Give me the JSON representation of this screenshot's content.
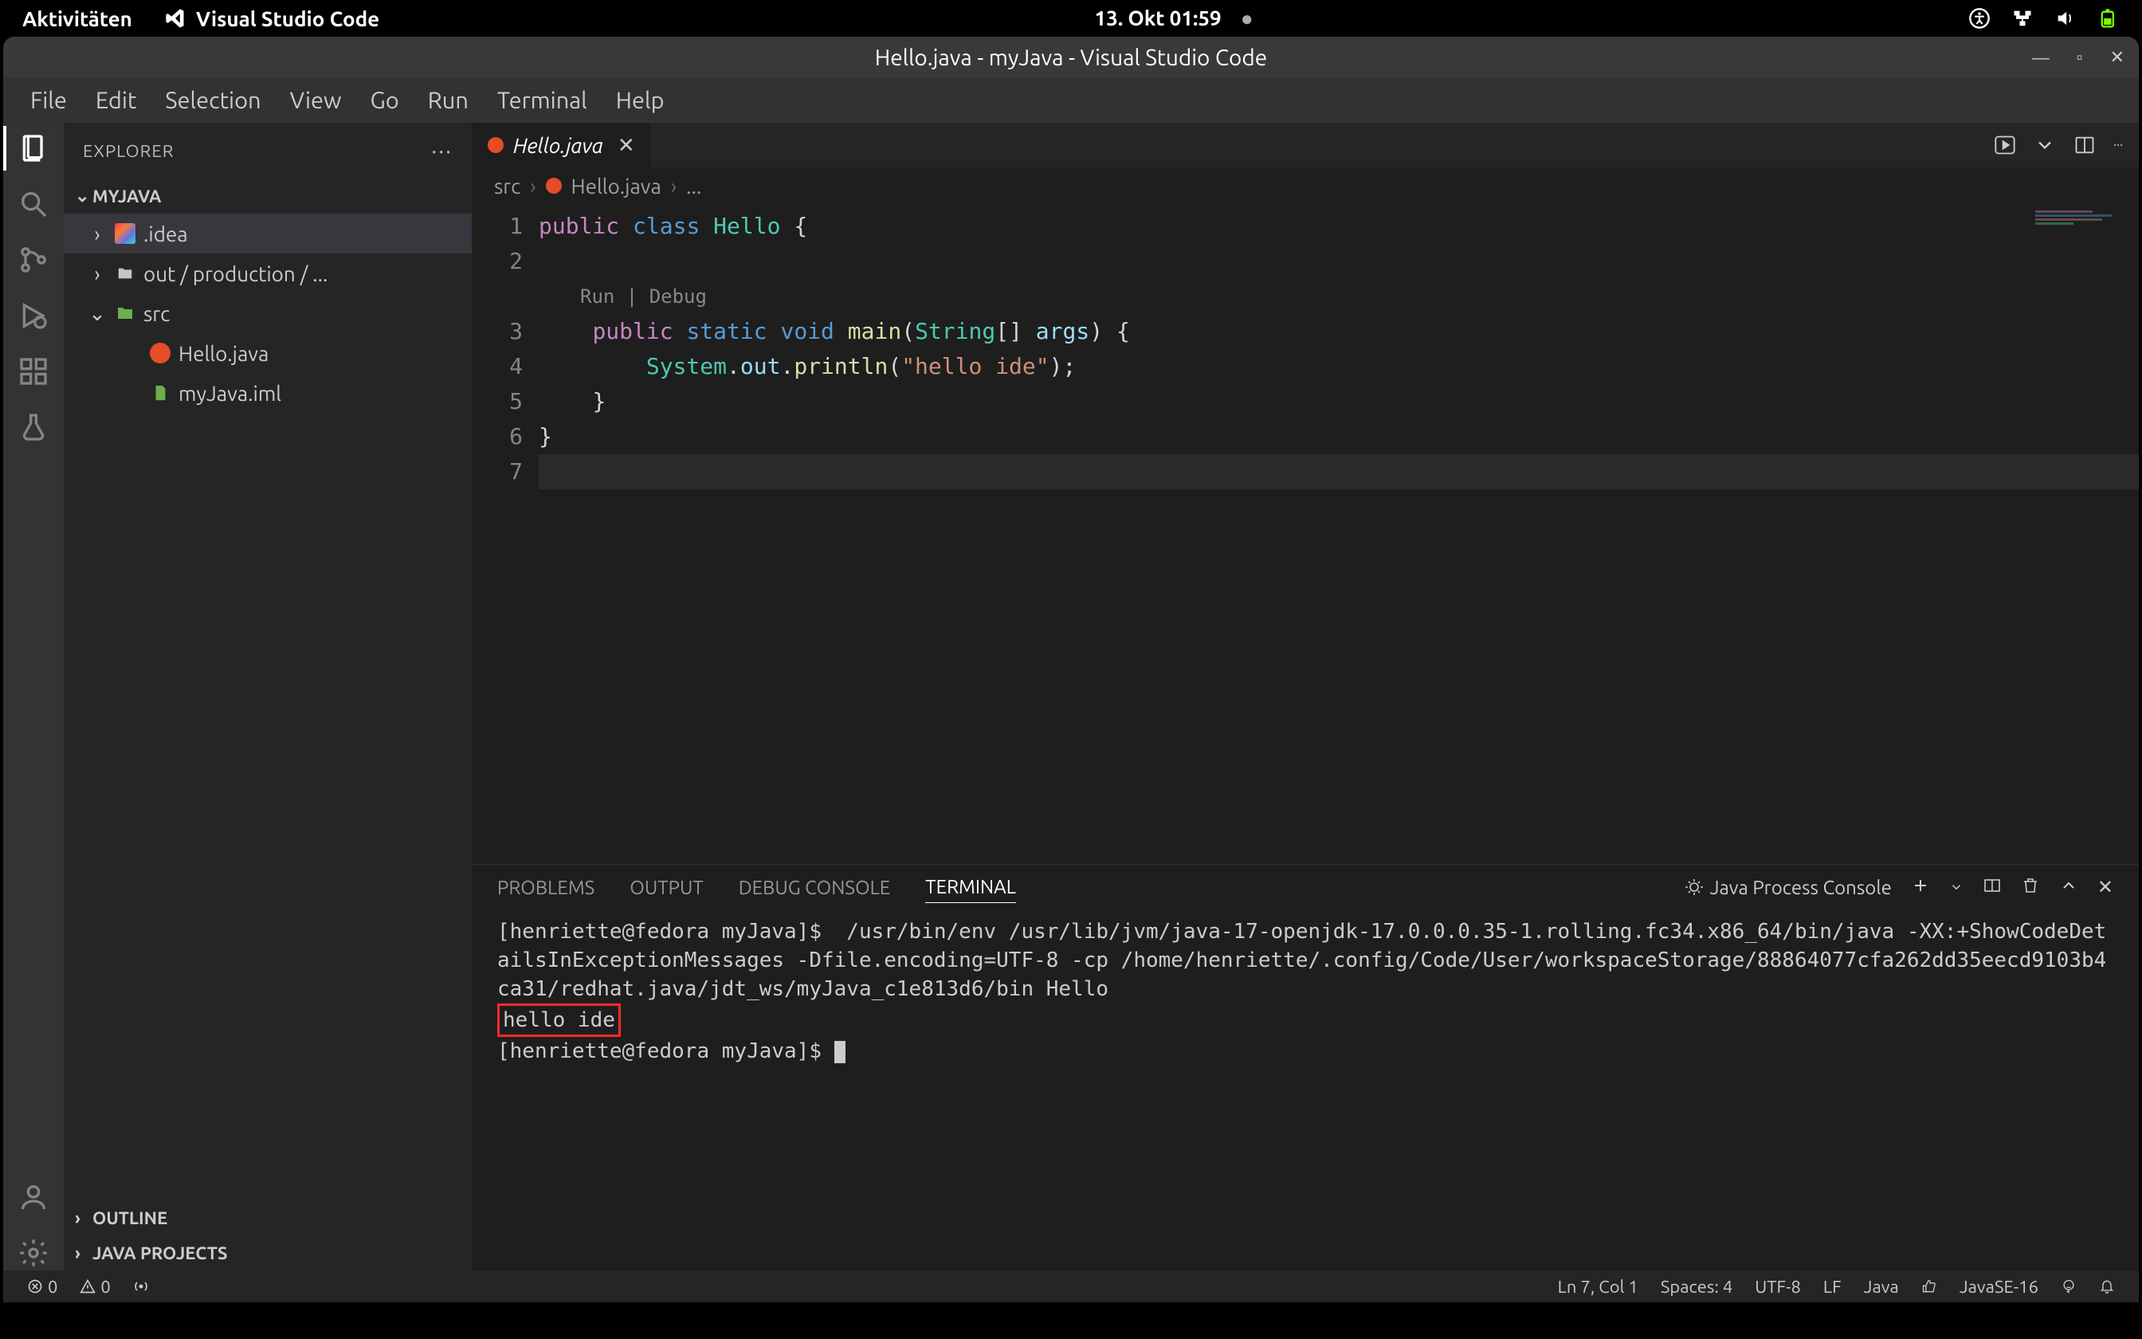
{
  "sysbar": {
    "activities": "Aktivitäten",
    "app_name": "Visual Studio Code",
    "datetime": "13. Okt  01:59"
  },
  "title": "Hello.java - myJava - Visual Studio Code",
  "menu": [
    "File",
    "Edit",
    "Selection",
    "View",
    "Go",
    "Run",
    "Terminal",
    "Help"
  ],
  "explorer": {
    "header": "EXPLORER",
    "project": "MYJAVA",
    "items": [
      {
        "name": ".idea",
        "kind": "idea",
        "depth": 1,
        "expanded": false,
        "chev": "›",
        "selected": true
      },
      {
        "name": "out / production / ...",
        "kind": "folder",
        "depth": 1,
        "expanded": false,
        "chev": "›"
      },
      {
        "name": "src",
        "kind": "src",
        "depth": 1,
        "expanded": true,
        "chev": "⌄"
      },
      {
        "name": "Hello.java",
        "kind": "java",
        "depth": 2
      },
      {
        "name": "myJava.iml",
        "kind": "iml",
        "depth": 2
      }
    ],
    "outline": "OUTLINE",
    "java_projects": "JAVA PROJECTS"
  },
  "tab": {
    "label": "Hello.java"
  },
  "breadcrumb": {
    "p1": "src",
    "p2": "Hello.java",
    "p3": "..."
  },
  "codelens": "Run | Debug",
  "code_tokens": {
    "l1": {
      "a": "public",
      "b": "class",
      "c": "Hello",
      "d": "{"
    },
    "l3": {
      "a": "public",
      "b": "static",
      "c": "void",
      "d": "main",
      "e": "String",
      "f": "args"
    },
    "l4": {
      "a": "System",
      "b": "out",
      "c": "println",
      "d": "\"hello ide\""
    }
  },
  "line_numbers": [
    "1",
    "2",
    "",
    "3",
    "4",
    "5",
    "6",
    "7"
  ],
  "panel": {
    "tabs": [
      "PROBLEMS",
      "OUTPUT",
      "DEBUG CONSOLE",
      "TERMINAL"
    ],
    "active": 3,
    "dropdown": "Java Process Console",
    "terminal": {
      "line1": "[henriette@fedora myJava]$  /usr/bin/env /usr/lib/jvm/java-17-openjdk-17.0.0.0.35-1.rolling.fc34.x86_64/bin/java -XX:+ShowCodeDetailsInExceptionMessages -Dfile.encoding=UTF-8 -cp /home/henriette/.config/Code/User/workspaceStorage/88864077cfa262dd35eecd9103b4ca31/redhat.java/jdt_ws/myJava_c1e813d6/bin Hello",
      "highlight": "hello ide",
      "line3": "[henriette@fedora myJava]$ "
    }
  },
  "status": {
    "errors": "0",
    "warnings": "0",
    "ln_col": "Ln 7, Col 1",
    "spaces": "Spaces: 4",
    "encoding": "UTF-8",
    "eol": "LF",
    "lang": "Java",
    "jdk": "JavaSE-16"
  }
}
